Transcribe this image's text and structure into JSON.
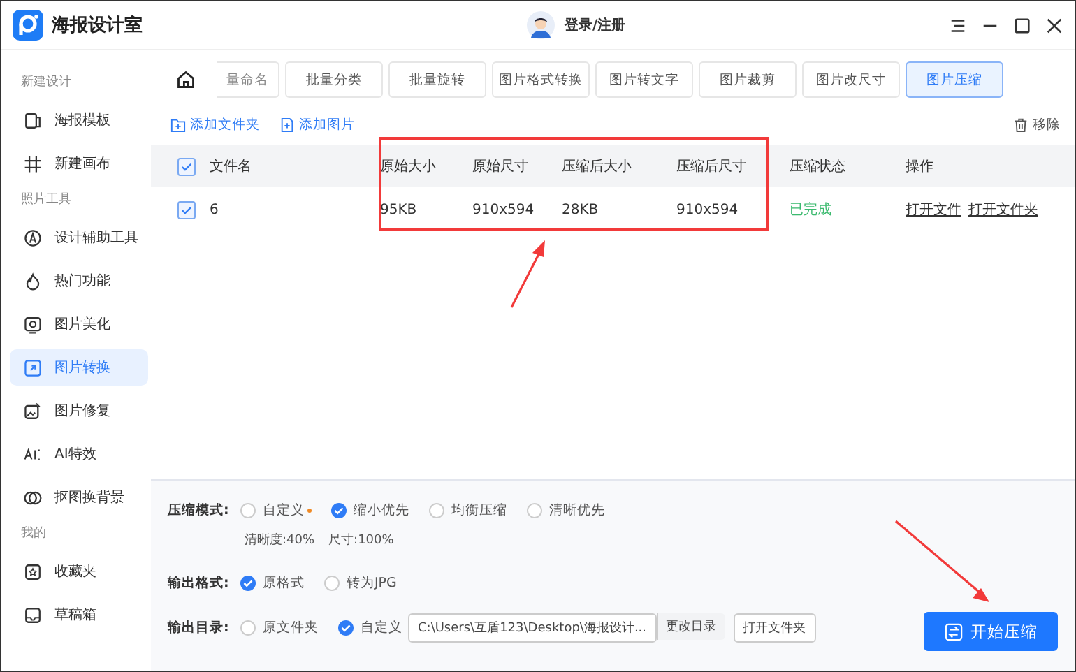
{
  "app": {
    "title": "海报设计室"
  },
  "user": {
    "label": "登录/注册"
  },
  "sidebar": [
    {
      "title": "新建设计",
      "items": [
        {
          "label": "海报模板",
          "selected": false
        },
        {
          "label": "新建画布",
          "selected": false
        }
      ]
    },
    {
      "title": "照片工具",
      "items": [
        {
          "label": "设计辅助工具",
          "selected": false
        },
        {
          "label": "热门功能",
          "selected": false
        },
        {
          "label": "图片美化",
          "selected": false
        },
        {
          "label": "图片转换",
          "selected": true
        },
        {
          "label": "图片修复",
          "selected": false
        },
        {
          "label": "AI特效",
          "selected": false
        },
        {
          "label": "抠图换背景",
          "selected": false
        }
      ]
    },
    {
      "title": "我的",
      "items": [
        {
          "label": "收藏夹",
          "selected": false
        },
        {
          "label": "草稿箱",
          "selected": false
        }
      ]
    }
  ],
  "tool_tabs": [
    {
      "label": "量命名",
      "selected": false
    },
    {
      "label": "批量分类",
      "selected": false
    },
    {
      "label": "批量旋转",
      "selected": false
    },
    {
      "label": "图片格式转换",
      "selected": false
    },
    {
      "label": "图片转文字",
      "selected": false
    },
    {
      "label": "图片裁剪",
      "selected": false
    },
    {
      "label": "图片改尺寸",
      "selected": false
    },
    {
      "label": "图片压缩",
      "selected": true
    }
  ],
  "toolbar": {
    "add_folder": "添加文件夹",
    "add_image": "添加图片",
    "remove": "移除"
  },
  "table": {
    "all_checked": true,
    "columns": [
      "文件名",
      "原始大小",
      "原始尺寸",
      "压缩后大小",
      "压缩后尺寸",
      "压缩状态",
      "操作"
    ],
    "rows": [
      {
        "checked": true,
        "cells": [
          "6",
          "95KB",
          "910x594",
          "28KB",
          "910x594"
        ],
        "status": "已完成",
        "actions": [
          "打开文件",
          "打开文件夹"
        ]
      }
    ]
  },
  "settings": {
    "mode": {
      "label": "压缩模式:",
      "options": [
        {
          "label": "自定义",
          "selected": false
        },
        {
          "label": "缩小优先",
          "selected": true
        },
        {
          "label": "均衡压缩",
          "selected": false
        },
        {
          "label": "清晰优先",
          "selected": false
        }
      ],
      "notes": [
        "清晰度:40%",
        "尺寸:100%"
      ]
    },
    "format": {
      "label": "输出格式:",
      "options": [
        {
          "label": "原格式",
          "selected": true
        },
        {
          "label": "转为JPG",
          "selected": false
        }
      ]
    },
    "output": {
      "label": "输出目录:",
      "options": [
        {
          "label": "原文件夹",
          "selected": false
        },
        {
          "label": "自定义",
          "selected": true
        }
      ],
      "path": "C:\\Users\\互盾123\\Desktop\\海报设计...",
      "change_button": "更改目录",
      "open_button": "打开文件夹"
    }
  },
  "start_button": "开始压缩"
}
